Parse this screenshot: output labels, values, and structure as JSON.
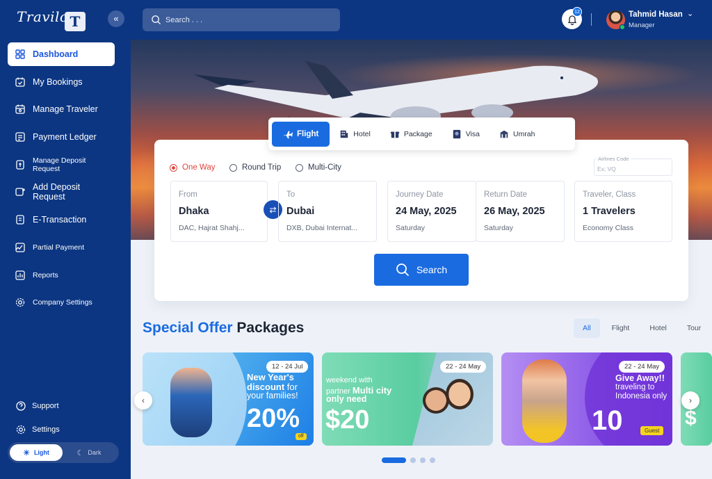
{
  "brand": {
    "logo_text": "Travilo",
    "mark": "T",
    "collapse_glyph": "«"
  },
  "sidebar": {
    "items": [
      {
        "label": "Dashboard",
        "icon": "dashboard-grid-icon"
      },
      {
        "label": "My Bookings",
        "icon": "calendar-check-icon"
      },
      {
        "label": "Manage Traveler",
        "icon": "calendar-user-icon"
      },
      {
        "label": "Payment Ledger",
        "icon": "ledger-icon"
      },
      {
        "label": "Manage Deposit Request",
        "icon": "deposit-icon"
      },
      {
        "label": "Add Deposit Request",
        "icon": "add-deposit-icon"
      },
      {
        "label": "E-Transaction",
        "icon": "transaction-icon"
      },
      {
        "label": "Partial Payment",
        "icon": "partial-payment-icon"
      },
      {
        "label": "Reports",
        "icon": "reports-icon"
      },
      {
        "label": "Company Settings",
        "icon": "gear-icon"
      }
    ],
    "support": "Support",
    "settings": "Settings",
    "theme": {
      "light": "Light",
      "dark": "Dark",
      "selected": "Light"
    }
  },
  "topbar": {
    "search_placeholder": "Search . . .",
    "notifications_count": "12",
    "user": {
      "name": "Tahmid Hasan",
      "role": "Manager"
    }
  },
  "booking": {
    "tabs": [
      "Flight",
      "Hotel",
      "Package",
      "Visa",
      "Umrah"
    ],
    "active_tab": "Flight",
    "trip_types": [
      "One Way",
      "Round Trip",
      "Multi-City"
    ],
    "selected_trip": "One Way",
    "airline_code": {
      "label": "Airlines Code",
      "placeholder": "Ex; VQ"
    },
    "from": {
      "label": "From",
      "city": "Dhaka",
      "airport": "DAC, Hajrat Shahj..."
    },
    "to": {
      "label": "To",
      "city": "Dubai",
      "airport": "DXB, Dubai Internat..."
    },
    "journey": {
      "label": "Journey Date",
      "date": "24 May, 2025",
      "day": "Saturday"
    },
    "return": {
      "label": "Return Date",
      "date": "26 May, 2025",
      "day": "Saturday"
    },
    "traveler": {
      "label": "Traveler, Class",
      "count": "1 Travelers",
      "class": "Economy Class"
    },
    "search_label": "Search"
  },
  "offers": {
    "title_accent": "Special Offer",
    "title_rest": "Packages",
    "filters": [
      "All",
      "Flight",
      "Hotel",
      "Tour"
    ],
    "active_filter": "All",
    "cards": [
      {
        "date": "12 - 24 Jul",
        "headline": "New Year's",
        "line2": "discount",
        "line2b": " for",
        "line3": "your families!",
        "big": "20%",
        "tag": "off"
      },
      {
        "date": "22 - 24 May",
        "line1": "weekend with",
        "line2": "partner ",
        "line2b": "Multi city",
        "line3": "only need",
        "big": "$20"
      },
      {
        "date": "22 - 24 May",
        "headline": "Give Away!!",
        "line2": "traveling to",
        "line3": "Indonesia only",
        "big": "10",
        "tag": "Guest"
      }
    ],
    "partial_card_big": "$"
  },
  "carousel": {
    "prev": "‹",
    "next": "›",
    "pages": 4,
    "current": 1
  },
  "colors": {
    "sidebar": "#0c3682",
    "accent": "#1a6be0",
    "active_radio": "#e0453b"
  }
}
